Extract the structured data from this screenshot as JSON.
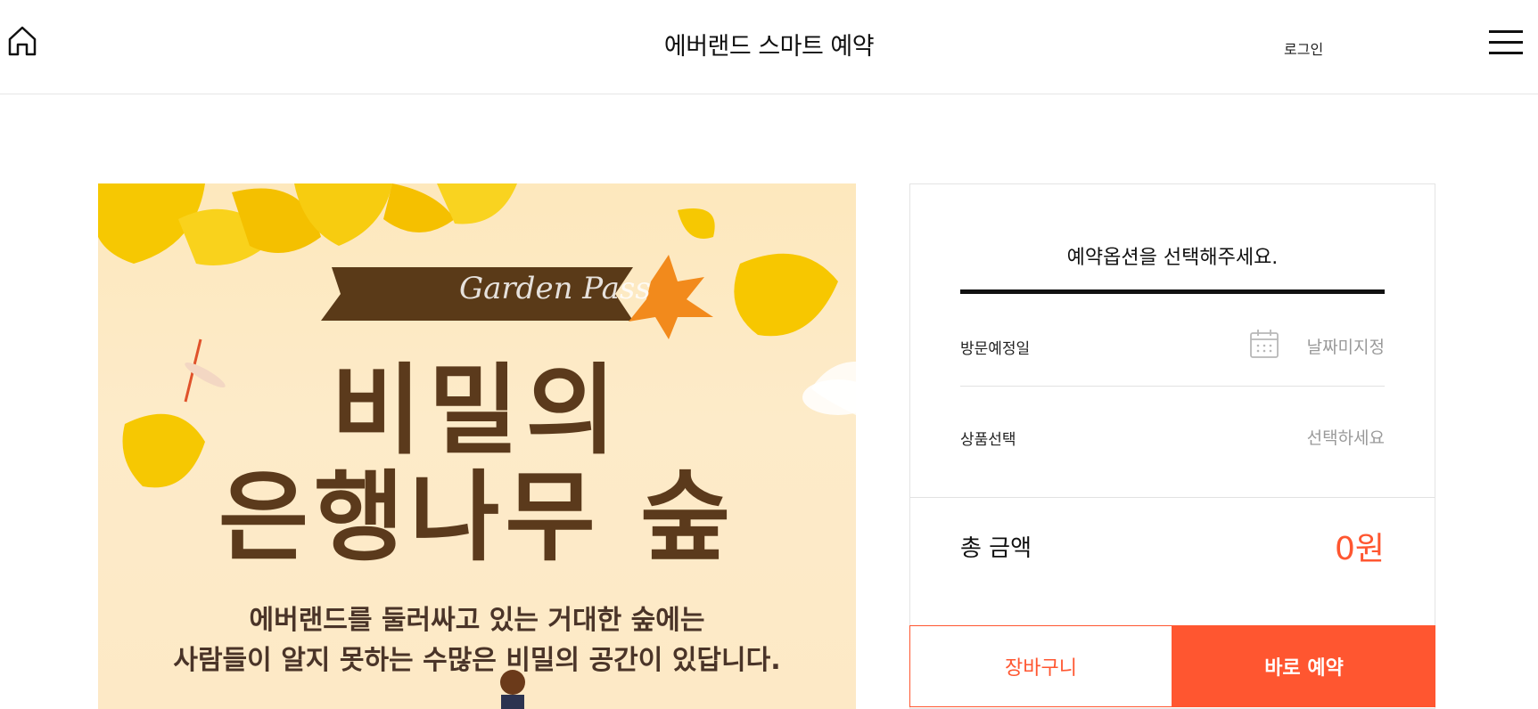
{
  "header": {
    "title": "에버랜드 스마트 예약",
    "login_label": "로그인"
  },
  "banner": {
    "ribbon_text": "Garden Pass",
    "title_line1": "비밀의",
    "title_line2": "은행나무 숲",
    "desc_line1": "에버랜드를 둘러싸고 있는 거대한 숲에는",
    "desc_line2": "사람들이 알지 못하는 수많은 비밀의 공간이 있답니다."
  },
  "booking": {
    "heading": "예약옵션을 선택해주세요.",
    "visit_date_label": "방문예정일",
    "visit_date_value": "날짜미지정",
    "product_label": "상품선택",
    "product_value": "선택하세요",
    "total_label": "총 금액",
    "total_value": "0원",
    "cart_button": "장바구니",
    "book_button": "바로 예약"
  },
  "colors": {
    "accent": "#ff5630",
    "banner_bg": "#fde8bd",
    "ginkgo": "#f5c400",
    "title_brown": "#5b3a1c"
  }
}
